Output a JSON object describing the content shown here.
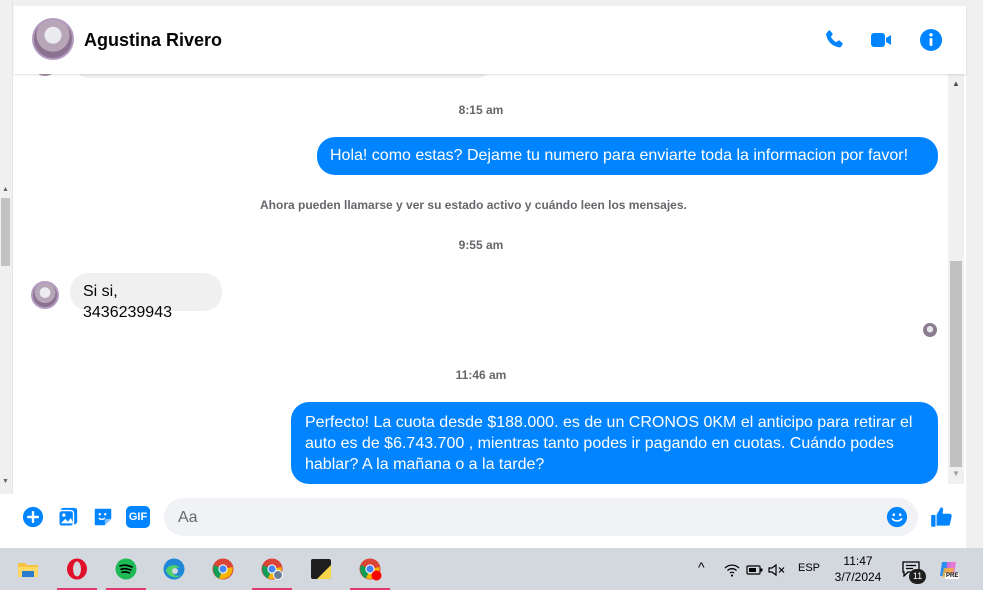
{
  "header": {
    "contact_name": "Agustina Rivero"
  },
  "messages": {
    "ts1": "8:15 am",
    "out1": "Hola! como estas? Dejame tu numero para enviarte toda la informacion por favor!",
    "system": "Ahora pueden llamarse y ver su estado activo y cuándo leen los mensajes.",
    "ts2": "9:55 am",
    "in1": "Si si, 3436239943",
    "ts3": "11:46 am",
    "out2": "Perfecto! La cuota desde $188.000. es de un CRONOS 0KM el anticipo para retirar el auto es de $6.743.700 , mientras tanto podes ir pagando en cuotas. Cuándo podes hablar? A la mañana o a la tarde?"
  },
  "composer": {
    "placeholder": "Aa",
    "gif_label": "GIF"
  },
  "taskbar": {
    "lang": "ESP",
    "time": "11:47",
    "date": "3/7/2024",
    "notif_count": "11",
    "copilot_badge": "PRE"
  },
  "colors": {
    "accent": "#0084ff",
    "incoming_bubble": "#f0f0f0",
    "timestamp": "#65676b",
    "taskbar": "#d3d7de"
  }
}
